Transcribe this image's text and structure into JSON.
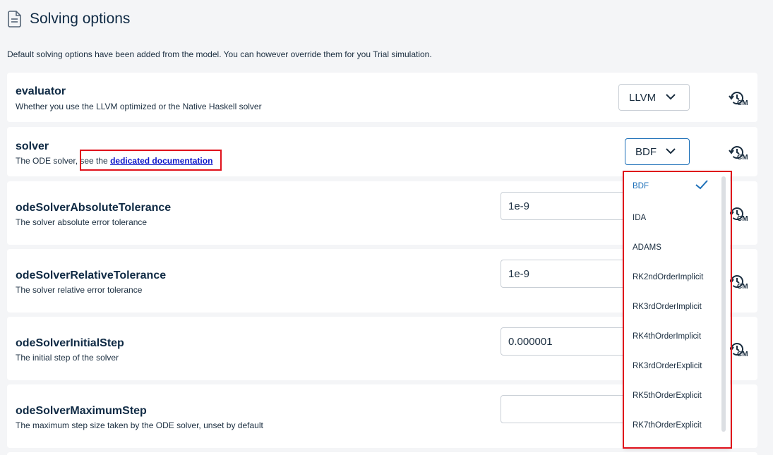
{
  "header": {
    "title": "Solving options",
    "icon": "document-icon"
  },
  "intro": "Default solving options have been added from the model. You can however override them for you Trial simulation.",
  "options": {
    "evaluator": {
      "name": "evaluator",
      "desc": "Whether you use the LLVM optimized or the Native Haskell solver",
      "value": "LLVM"
    },
    "solver": {
      "name": "solver",
      "desc_prefix": "The ODE solver",
      "desc_mid": ", see the ",
      "link": "dedicated documentation",
      "value": "BDF"
    },
    "abs_tol": {
      "name": "odeSolverAbsoluteTolerance",
      "desc": "The solver absolute error tolerance",
      "value": "1e-9"
    },
    "rel_tol": {
      "name": "odeSolverRelativeTolerance",
      "desc": "The solver relative error tolerance",
      "value": "1e-9"
    },
    "init_step": {
      "name": "odeSolverInitialStep",
      "desc": "The initial step of the solver",
      "value": "0.000001"
    },
    "max_step": {
      "name": "odeSolverMaximumStep",
      "desc": "The maximum step size taken by the ODE solver, unset by default",
      "value": ""
    }
  },
  "reset_label": "CM",
  "dropdown": {
    "options": [
      "BDF",
      "IDA",
      "ADAMS",
      "RK2ndOrderImplicit",
      "RK3rdOrderImplicit",
      "RK4thOrderImplicit",
      "RK3rdOrderExplicit",
      "RK5thOrderExplicit",
      "RK7thOrderExplicit"
    ],
    "selected": "BDF"
  },
  "colors": {
    "accent": "#1c6fb8",
    "highlight": "#e0111b",
    "link": "#0f17c9"
  }
}
